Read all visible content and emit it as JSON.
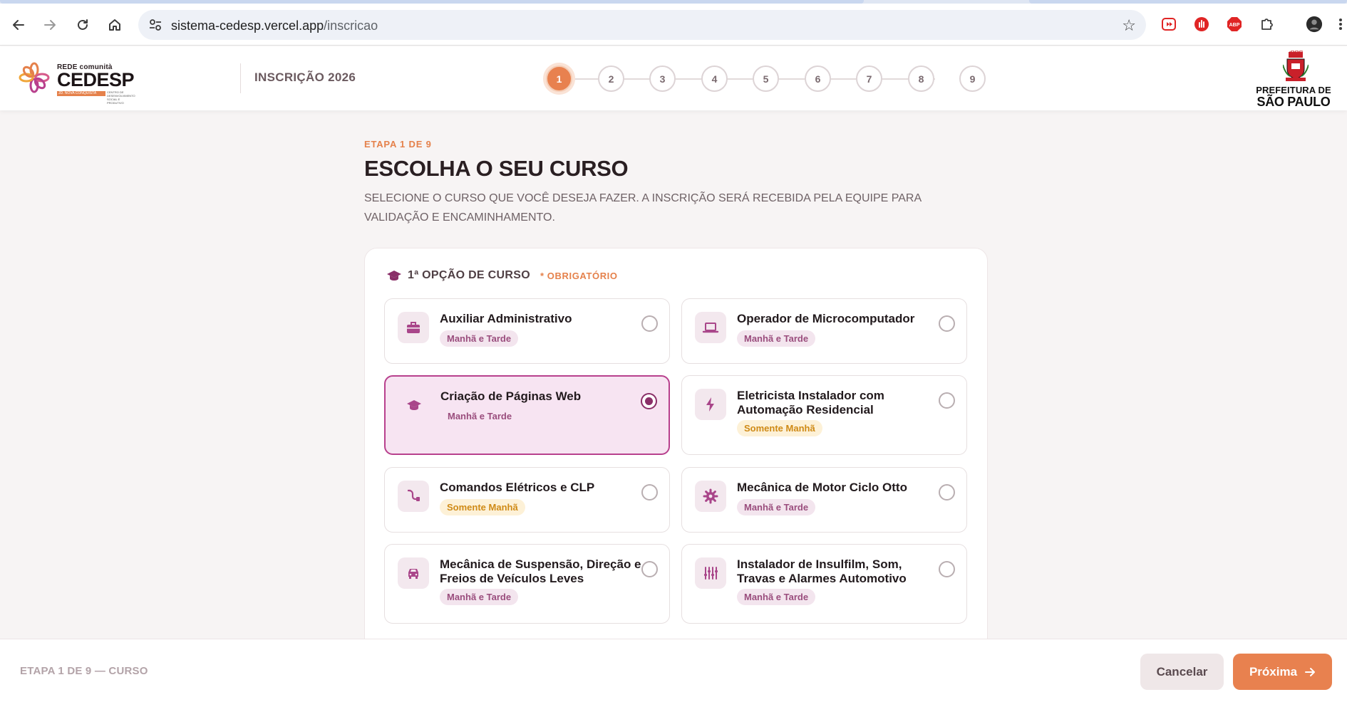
{
  "browser": {
    "url_host": "sistema-cedesp.vercel.app",
    "url_path": "/inscricao"
  },
  "header": {
    "logo": {
      "rede": "REDE comunità",
      "name": "CEDESP",
      "tag": "JD. NOVA CONQUISTA",
      "sub": "CENTRO DE DESENVOLVIMENTO SOCIAL E PRODUTIVO"
    },
    "title": "INSCRIÇÃO 2026",
    "steps": [
      "1",
      "2",
      "3",
      "4",
      "5",
      "6",
      "7",
      "8",
      "9"
    ],
    "active_step": 1,
    "prefeitura_line1": "PREFEITURA DE",
    "prefeitura_line2": "SÃO PAULO"
  },
  "main": {
    "eyebrow": "ETAPA 1 DE 9",
    "title": "ESCOLHA O SEU CURSO",
    "description": "SELECIONE O CURSO QUE VOCÊ DESEJA FAZER. A INSCRIÇÃO SERÁ RECEBIDA PELA EQUIPE PARA VALIDAÇÃO E ENCAMINHAMENTO.",
    "section_label": "1ª OPÇÃO DE CURSO",
    "section_required": "* OBRIGATÓRIO",
    "courses": [
      {
        "name": "Auxiliar Administrativo",
        "shift": "Manhã e Tarde",
        "icon": "briefcase-icon",
        "selected": false
      },
      {
        "name": "Operador de Microcomputador",
        "shift": "Manhã e Tarde",
        "icon": "laptop-icon",
        "selected": false
      },
      {
        "name": "Criação de Páginas Web",
        "shift": "Manhã e Tarde",
        "icon": "graduation-cap-icon",
        "selected": true
      },
      {
        "name": "Eletricista Instalador com Automação Residencial",
        "shift": "Somente Manhã",
        "icon": "lightning-icon",
        "selected": false
      },
      {
        "name": "Comandos Elétricos e CLP",
        "shift": "Somente Manhã",
        "icon": "plug-icon",
        "selected": false
      },
      {
        "name": "Mecânica de Motor Ciclo Otto",
        "shift": "Manhã e Tarde",
        "icon": "gear-icon",
        "selected": false
      },
      {
        "name": "Mecânica de Suspensão, Direção e Freios de Veículos Leves",
        "shift": "Manhã e Tarde",
        "icon": "car-icon",
        "selected": false
      },
      {
        "name": "Instalador de Insulfilm, Som, Travas e Alarmes Automotivo",
        "shift": "Manhã e Tarde",
        "icon": "sliders-icon",
        "selected": false
      }
    ]
  },
  "footer": {
    "status": "ETAPA 1 DE 9 — CURSO",
    "cancel_label": "Cancelar",
    "next_label": "Próxima"
  },
  "colors": {
    "accent": "#e8814f",
    "selected_border": "#b8408d",
    "selected_bg": "#f7e4f2",
    "icon_color": "#a9468a"
  }
}
